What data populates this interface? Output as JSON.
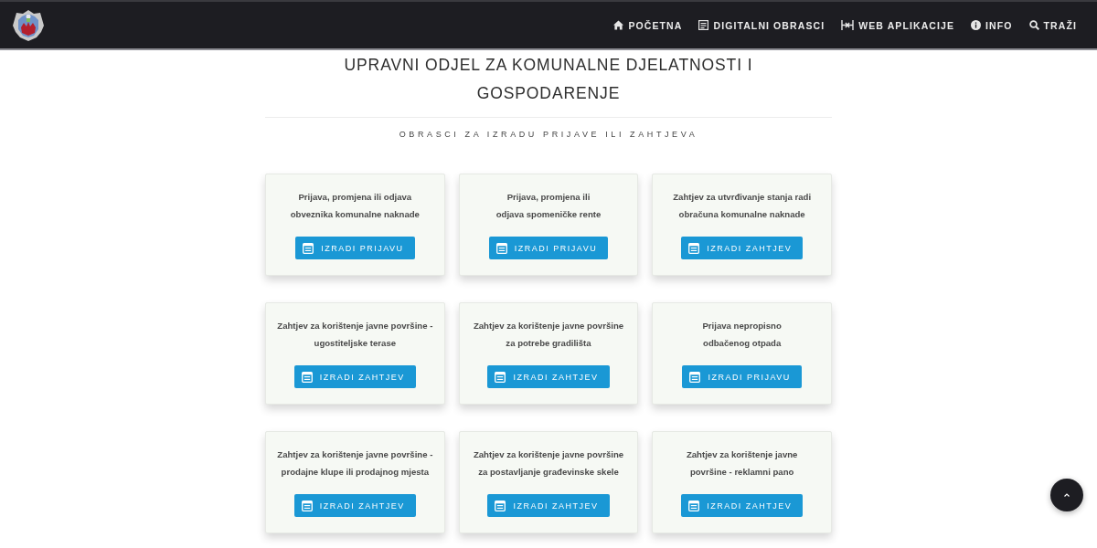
{
  "navbar": {
    "items": [
      {
        "label": "POČETNA",
        "kind": "home"
      },
      {
        "label": "DIGITALNI OBRASCI",
        "kind": "forms"
      },
      {
        "label": "WEB APLIKACIJE",
        "kind": "apps"
      },
      {
        "label": "INFO",
        "kind": "info"
      },
      {
        "label": "TRAŽI",
        "kind": "search"
      }
    ]
  },
  "header": {
    "title": "UPRAVNI ODJEL ZA KOMUNALNE DJELATNOSTI I GOSPODARENJE",
    "subtitle": "OBRASCI ZA IZRADU PRIJAVE ILI ZAHTJEVA"
  },
  "cards": [
    {
      "title": "Prijava, promjena ili odjava\nobveznika komunalne naknade",
      "button": "IZRADI PRIJAVU"
    },
    {
      "title": "Prijava, promjena ili\nodjava spomeničke rente",
      "button": "IZRADI PRIJAVU"
    },
    {
      "title": "Zahtjev za utvrđivanje stanja radi\nobračuna komunalne naknade",
      "button": "IZRADI ZAHTJEV"
    },
    {
      "title": "Zahtjev za korištenje javne površine -\nugostiteljske terase",
      "button": "IZRADI ZAHTJEV"
    },
    {
      "title": "Zahtjev za korištenje javne površine\nza potrebe gradilišta",
      "button": "IZRADI ZAHTJEV"
    },
    {
      "title": "Prijava nepropisno\nodbačenog otpada",
      "button": "IZRADI PRIJAVU"
    },
    {
      "title": "Zahtjev za korištenje javne površine -\nprodajne klupe ili prodajnog mjesta",
      "button": "IZRADI ZAHTJEV"
    },
    {
      "title": "Zahtjev za korištenje javne površine\nza postavljanje građevinske skele",
      "button": "IZRADI ZAHTJEV"
    },
    {
      "title": "Zahtjev za korištenje javne\npovršine - reklamni pano",
      "button": "IZRADI ZAHTJEV"
    }
  ]
}
